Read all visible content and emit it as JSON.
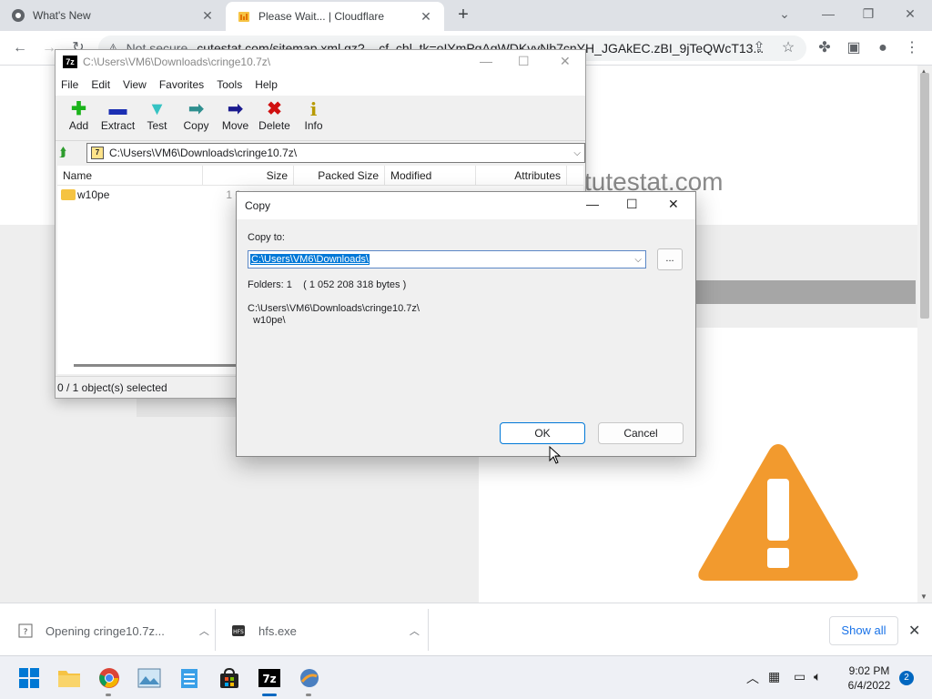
{
  "browser": {
    "tabs": [
      {
        "title": "What's New",
        "active": false
      },
      {
        "title": "Please Wait... | Cloudflare",
        "active": true
      }
    ],
    "new_tab": "+",
    "omnibox": {
      "security": "Not secure",
      "url": "cutestat.com/sitemap.xml.gz?__cf_chl_tk=oIYmPqAgWDKvyNb7cnYH_JGAkEC.zBI_9jTeQWcT13..."
    }
  },
  "page": {
    "site_text": "tutestat.com"
  },
  "sevenzip": {
    "title": "C:\\Users\\VM6\\Downloads\\cringe10.7z\\",
    "logo": "7z",
    "menu": [
      "File",
      "Edit",
      "View",
      "Favorites",
      "Tools",
      "Help"
    ],
    "toolbar": [
      {
        "label": "Add",
        "icon": "add-icon",
        "glyph": "✚",
        "color": "#1bb31b"
      },
      {
        "label": "Extract",
        "icon": "extract-icon",
        "glyph": "▬",
        "color": "#1b2fb3"
      },
      {
        "label": "Test",
        "icon": "test-icon",
        "glyph": "▼",
        "color": "#36c3c3"
      },
      {
        "label": "Copy",
        "icon": "copy-icon",
        "glyph": "➡",
        "color": "#2f8f8f"
      },
      {
        "label": "Move",
        "icon": "move-icon",
        "glyph": "➡",
        "color": "#1b1b8f"
      },
      {
        "label": "Delete",
        "icon": "delete-icon",
        "glyph": "✖",
        "color": "#d01010"
      },
      {
        "label": "Info",
        "icon": "info-icon",
        "glyph": "i",
        "color": "#b89a00"
      }
    ],
    "address": "C:\\Users\\VM6\\Downloads\\cringe10.7z\\",
    "columns": [
      "Name",
      "Size",
      "Packed Size",
      "Modified",
      "Attributes"
    ],
    "rows": [
      {
        "name": "w10pe",
        "size": "1 0"
      }
    ],
    "status": "0 / 1 object(s) selected"
  },
  "copy_dialog": {
    "title": "Copy",
    "copy_to_label": "Copy to:",
    "destination": "C:\\Users\\VM6\\Downloads\\",
    "browse": "...",
    "info": "Folders: 1    ( 1 052 208 318 bytes )",
    "source_line1": "C:\\Users\\VM6\\Downloads\\cringe10.7z\\",
    "source_line2": "  w10pe\\",
    "ok": "OK",
    "cancel": "Cancel"
  },
  "downloads": {
    "items": [
      {
        "label": "Opening cringe10.7z...",
        "icon": "archive-file-icon"
      },
      {
        "label": "hfs.exe",
        "icon": "hfs-exe-icon"
      }
    ],
    "show_all": "Show all"
  },
  "taskbar": {
    "time": "9:02 PM",
    "date": "6/4/2022",
    "notifications": "2",
    "apps": [
      "start",
      "file-explorer",
      "chrome",
      "photos",
      "notepad",
      "store",
      "7zip",
      "hfs"
    ]
  },
  "colors": {
    "accent": "#0078d7",
    "warning": "#f29a2e",
    "chrome_link": "#1a73e8"
  }
}
